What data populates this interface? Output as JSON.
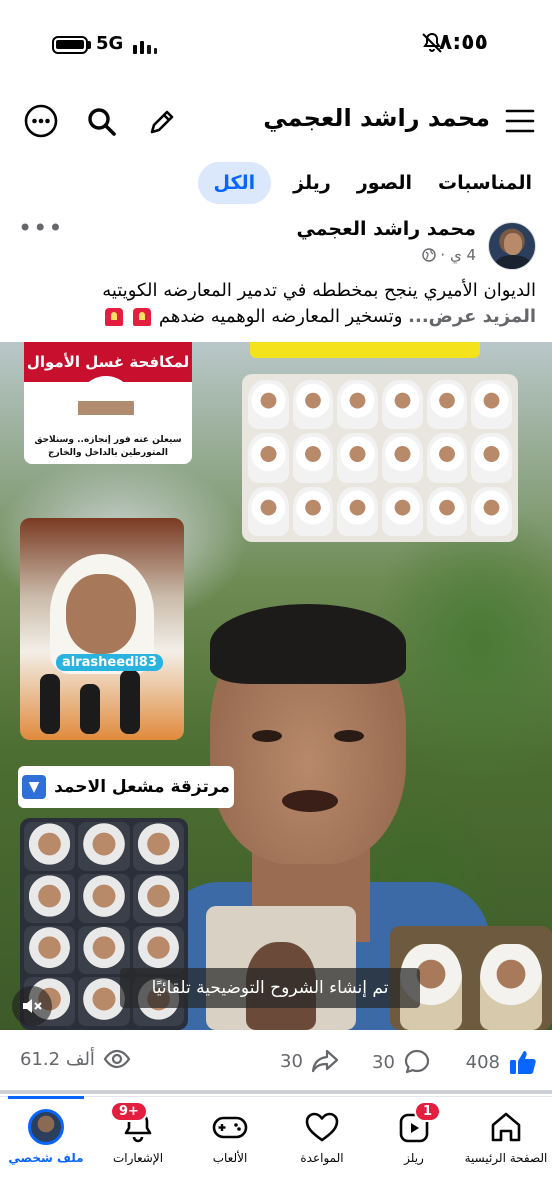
{
  "status_bar": {
    "time": "٨:٥٥",
    "network": "5G"
  },
  "header": {
    "title": "محمد راشد العجمي"
  },
  "tabs": [
    {
      "label": "الكل",
      "active": true
    },
    {
      "label": "ريلز"
    },
    {
      "label": "الصور"
    },
    {
      "label": "المناسبات"
    }
  ],
  "post": {
    "author": "محمد راشد العجمي",
    "time": "4 ي ·",
    "text_line1": "الديوان الأميري ينجح بمخططه في تدمير المعارضه الكويتيه",
    "text_line2": "وتسخير المعارضه الوهميه ضدهم",
    "see_more": "المزيد عرض...",
    "video": {
      "news_banner": "لمكافحة غسل الأموال",
      "news_caption": "سيعلن عنه فور إنجازه.. وسنلاحق المتورطين بالداخل والخارج",
      "watermark": "alrasheedi83",
      "label_box": "مرتزقة مشعل الاحمد",
      "auto_caption": "تم إنشاء الشروح التوضيحية تلقائيًا"
    },
    "stats": {
      "likes": "408",
      "comments": "30",
      "shares": "30",
      "views": "61.2 ألف"
    }
  },
  "bottom_nav": [
    {
      "label": "الصفحة الرئيسية",
      "icon": "home-icon"
    },
    {
      "label": "ريلز",
      "icon": "reels-icon",
      "badge": "1"
    },
    {
      "label": "المواعدة",
      "icon": "dating-icon"
    },
    {
      "label": "الألعاب",
      "icon": "gaming-icon"
    },
    {
      "label": "الإشعارات",
      "icon": "bell-icon",
      "badge": "9+"
    },
    {
      "label": "ملف شخصي",
      "icon": "profile-avatar",
      "active": true
    }
  ],
  "colors": {
    "accent": "#0866ff",
    "badge": "#e41e3f",
    "muted": "#65676b"
  }
}
